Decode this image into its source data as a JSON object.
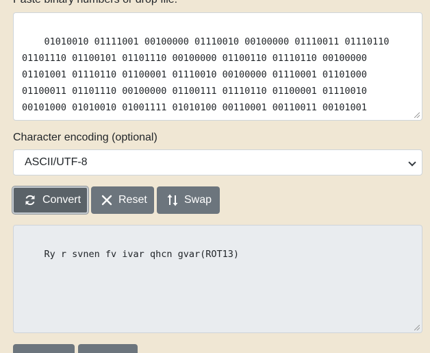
{
  "input": {
    "label": "Paste binary numbers or drop file:",
    "value": "01010010 01111001 00100000 01110010 00100000 01110011 01110110\n01101110 01100101 01101110 00100000 01100110 01110110 00100000\n01101001 01110110 01100001 01110010 00100000 01110001 01101000\n01100011 01101110 00100000 01100111 01110110 01100001 01110010\n00101000 01010010 01001111 01010100 00110001 00110011 00101001"
  },
  "encoding": {
    "label": "Character encoding (optional)",
    "selected": "ASCII/UTF-8"
  },
  "toolbar": {
    "convert_label": "Convert",
    "reset_label": "Reset",
    "swap_label": "Swap"
  },
  "output": {
    "value": "Ry r svnen fv ivar qhcn gvar(ROT13)"
  },
  "icons": {
    "convert": "refresh-icon",
    "reset": "close-icon",
    "swap": "swap-vertical-icon"
  }
}
